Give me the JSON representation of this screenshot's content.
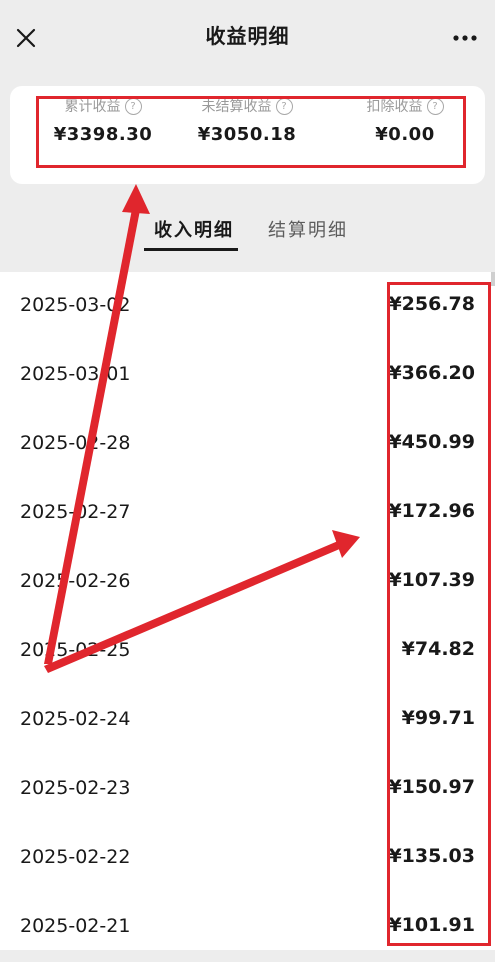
{
  "header": {
    "title": "收益明细",
    "close_icon": "close-icon",
    "more_icon": "more-icon"
  },
  "summary": {
    "cumulative": {
      "label": "累计收益",
      "value": "¥3398.30"
    },
    "unsettled": {
      "label": "未结算收益",
      "value": "¥3050.18"
    },
    "deducted": {
      "label": "扣除收益",
      "value": "¥0.00"
    },
    "help_glyph": "?"
  },
  "tabs": [
    {
      "label": "收入明细",
      "active": true
    },
    {
      "label": "结算明细",
      "active": false
    }
  ],
  "rows": [
    {
      "date": "2025-03-02",
      "amount": "¥256.78"
    },
    {
      "date": "2025-03-01",
      "amount": "¥366.20"
    },
    {
      "date": "2025-02-28",
      "amount": "¥450.99"
    },
    {
      "date": "2025-02-27",
      "amount": "¥172.96"
    },
    {
      "date": "2025-02-26",
      "amount": "¥107.39"
    },
    {
      "date": "2025-02-25",
      "amount": "¥74.82"
    },
    {
      "date": "2025-02-24",
      "amount": "¥99.71"
    },
    {
      "date": "2025-02-23",
      "amount": "¥150.97"
    },
    {
      "date": "2025-02-22",
      "amount": "¥135.03"
    },
    {
      "date": "2025-02-21",
      "amount": "¥101.91"
    }
  ],
  "colors": {
    "annotation_red": "#e0262d",
    "background": "#ededed",
    "card": "#ffffff"
  }
}
